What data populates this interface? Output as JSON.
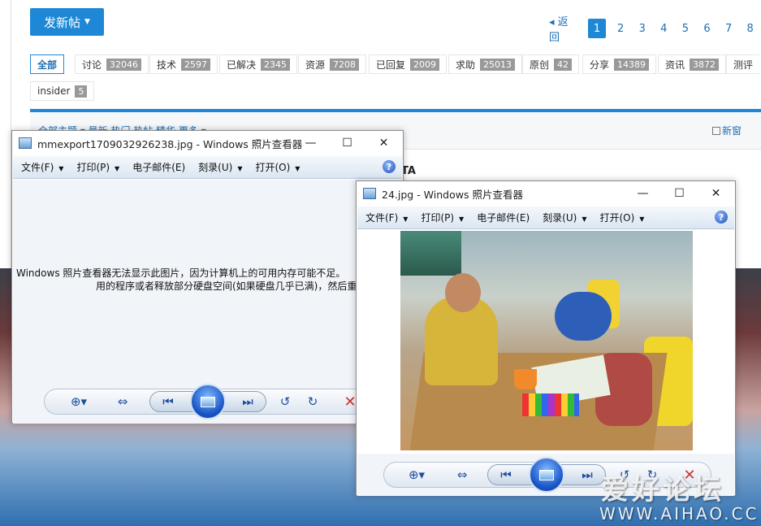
{
  "forum": {
    "post_button": "发新帖",
    "pager": {
      "back": "返回",
      "pages": [
        "1",
        "2",
        "3",
        "4",
        "5",
        "6",
        "7",
        "8"
      ],
      "current": "1"
    },
    "tags": [
      {
        "label": "全部",
        "count": ""
      },
      {
        "label": "讨论",
        "count": "32046"
      },
      {
        "label": "技术",
        "count": "2597"
      },
      {
        "label": "已解决",
        "count": "2345"
      },
      {
        "label": "资源",
        "count": "7208"
      },
      {
        "label": "已回复",
        "count": "2009"
      },
      {
        "label": "求助",
        "count": "25013"
      },
      {
        "label": "原创",
        "count": "42"
      },
      {
        "label": "分享",
        "count": "14389"
      },
      {
        "label": "资讯",
        "count": "3872"
      },
      {
        "label": "测评",
        "count": ""
      },
      {
        "label": "insider",
        "count": "5"
      }
    ],
    "subnav_left": "全部主题 ▾   最新  热门  热帖  精华  更多 ▾",
    "new_window": "新窗",
    "fragment": "TA"
  },
  "viewer1": {
    "title": "mmexport1709032926238.jpg - Windows 照片查看器",
    "menu": [
      "文件(F)",
      "打印(P)",
      "电子邮件(E)",
      "刻录(U)",
      "打开(O)"
    ],
    "error_line1": "Windows 照片查看器无法显示此图片，因为计算机上的可用内存可能不足。",
    "error_line2": "用的程序或者释放部分硬盘空间(如果硬盘几乎已满)，然后重"
  },
  "viewer2": {
    "title": "24.jpg - Windows 照片查看器",
    "menu": [
      "文件(F)",
      "打印(P)",
      "电子邮件(E)",
      "刻录(U)",
      "打开(O)"
    ]
  },
  "watermark": {
    "text": "爱好论坛",
    "url": "WWW.AIHAO.CC"
  }
}
